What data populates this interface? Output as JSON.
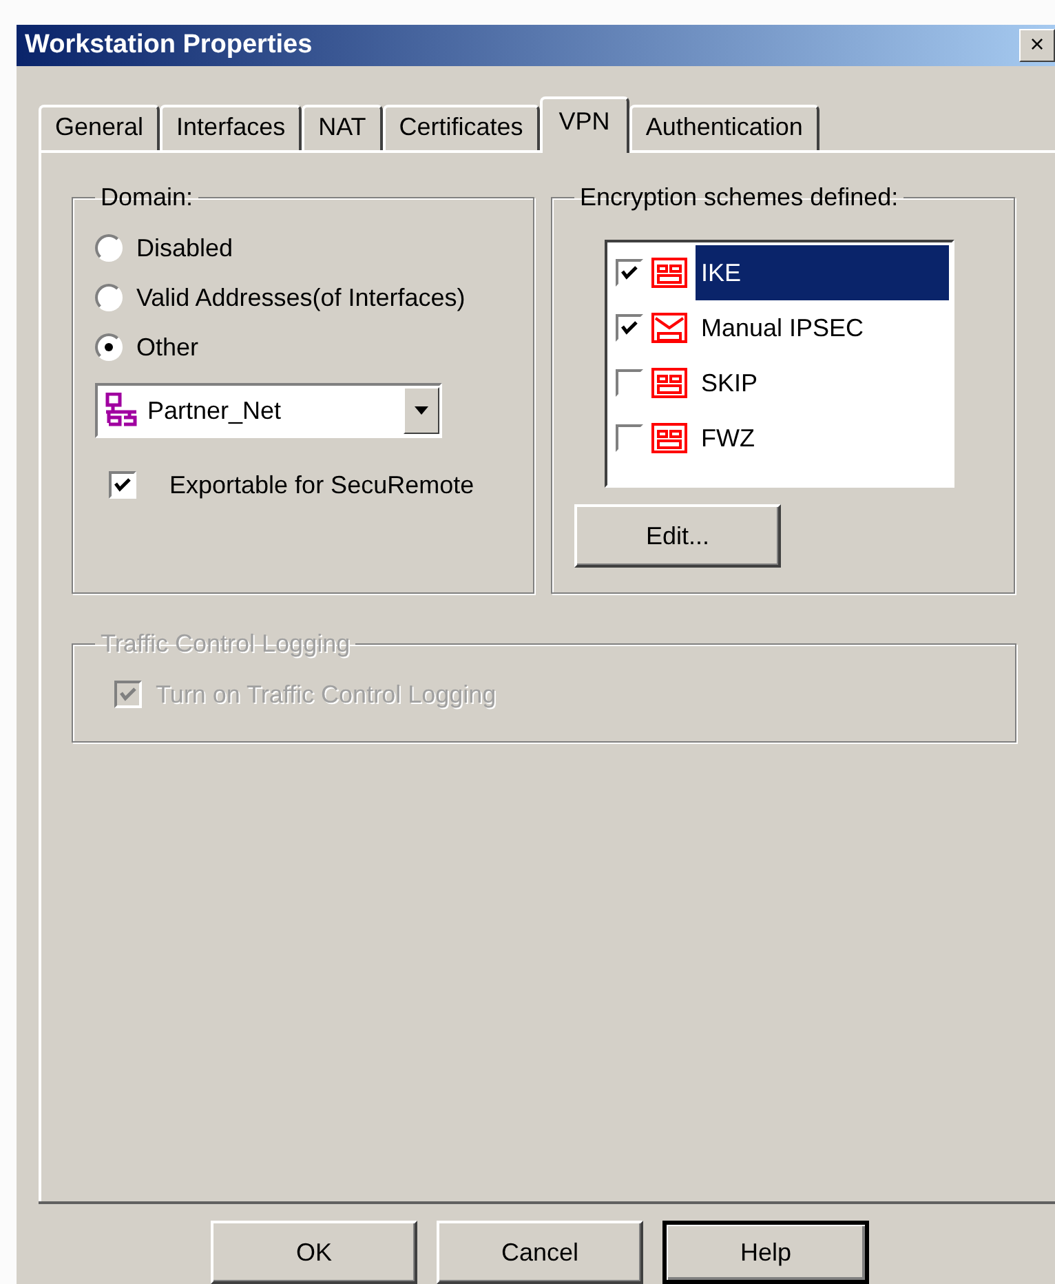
{
  "window": {
    "title": "Workstation Properties",
    "close": "×"
  },
  "tabs": [
    {
      "label": "General",
      "selected": false
    },
    {
      "label": "Interfaces",
      "selected": false
    },
    {
      "label": "NAT",
      "selected": false
    },
    {
      "label": "Certificates",
      "selected": false
    },
    {
      "label": "VPN",
      "selected": true
    },
    {
      "label": "Authentication",
      "selected": false
    }
  ],
  "domain": {
    "title": "Domain:",
    "options": [
      {
        "label": "Disabled",
        "selected": false
      },
      {
        "label": "Valid Addresses(of Interfaces)",
        "selected": false
      },
      {
        "label": "Other",
        "selected": true
      }
    ],
    "dropdown": {
      "value": "Partner_Net"
    },
    "exportable": {
      "label": "Exportable for SecuRemote",
      "checked": true
    }
  },
  "encryption": {
    "title": "Encryption schemes defined:",
    "schemes": [
      {
        "label": "IKE",
        "checked": true,
        "selected": true
      },
      {
        "label": "Manual IPSEC",
        "checked": true,
        "selected": false
      },
      {
        "label": "SKIP",
        "checked": false,
        "selected": false
      },
      {
        "label": "FWZ",
        "checked": false,
        "selected": false
      }
    ],
    "edit_button": "Edit..."
  },
  "traffic": {
    "title": "Traffic Control Logging",
    "disabled": true,
    "checkbox": {
      "label": "Turn on Traffic Control Logging",
      "checked": true
    }
  },
  "buttons": [
    {
      "label": "OK",
      "default": false
    },
    {
      "label": "Cancel",
      "default": false
    },
    {
      "label": "Help",
      "default": true
    }
  ]
}
